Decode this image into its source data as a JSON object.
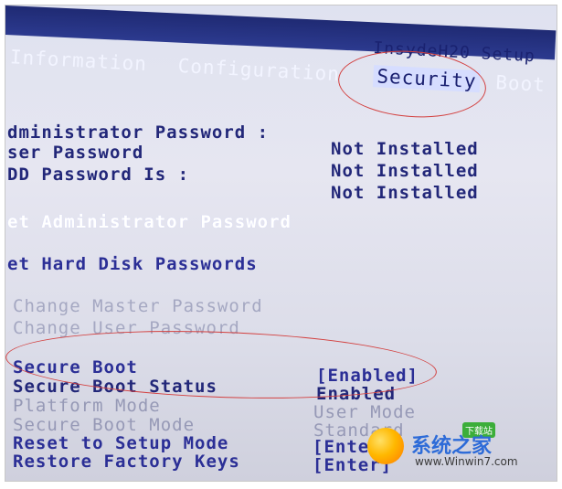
{
  "header": {
    "brand": "InsydeH20 Setup",
    "tabs": [
      {
        "label": "Information"
      },
      {
        "label": "Configuration"
      },
      {
        "label": "Security"
      },
      {
        "label": "Boot"
      }
    ]
  },
  "security": {
    "status_rows": [
      {
        "label": "dministrator Password :",
        "value": "Not Installed"
      },
      {
        "label": "ser Password",
        "value": "Not Installed"
      },
      {
        "label": "DD Password Is :",
        "value": "Not Installed"
      }
    ],
    "set_admin": "et Administrator Password",
    "set_hdd": "et Hard Disk Passwords",
    "change_master": "Change Master Password",
    "change_user": "Change User Password",
    "secure_boot": {
      "label": "Secure Boot",
      "value": "[Enabled]"
    },
    "secure_boot_status": {
      "label": "Secure Boot Status",
      "value": "Enabled"
    },
    "platform_mode": {
      "label": "Platform Mode",
      "value": "User Mode"
    },
    "secure_boot_mode": {
      "label": "Secure Boot Mode",
      "value": "Standard"
    },
    "reset_setup": {
      "label": "Reset to Setup Mode",
      "value": "[Enter]"
    },
    "restore_keys": {
      "label": "Restore Factory Keys",
      "value": "[Enter]"
    }
  },
  "watermark": {
    "title": "系统之家",
    "badge": "下载站",
    "url": "www.Winwin7.com"
  },
  "colors": {
    "header_bg": "#2c3a8f",
    "screen_bg": "#e3e4ef",
    "highlight": "#ffffff",
    "annotation": "#d3403f"
  }
}
